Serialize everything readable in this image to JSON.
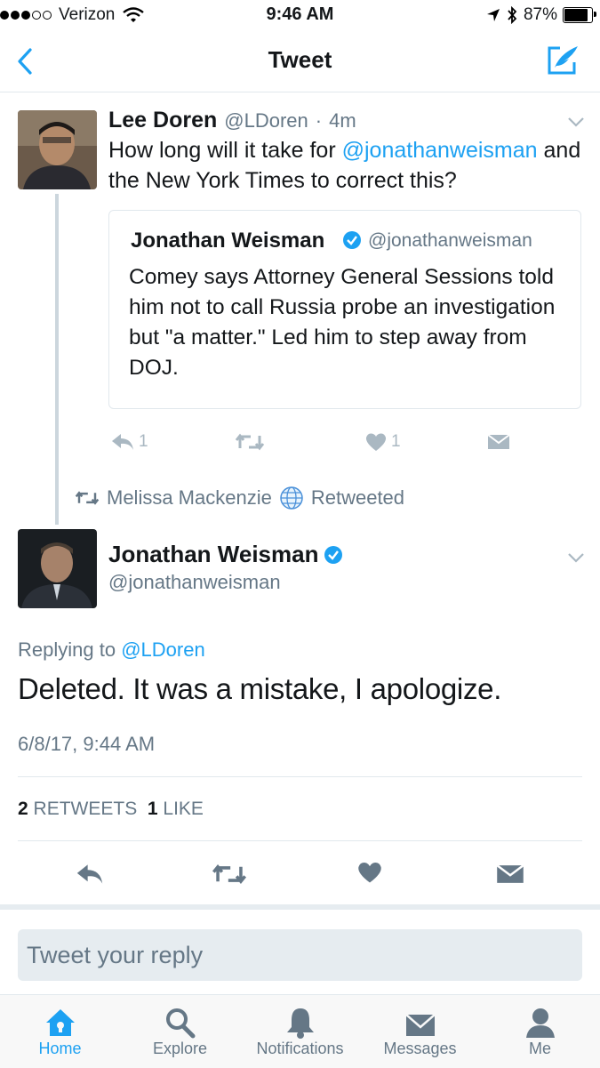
{
  "status_bar": {
    "carrier": "Verizon",
    "time": "9:46 AM",
    "battery": "87%",
    "battery_level": 0.87
  },
  "nav": {
    "title": "Tweet"
  },
  "quoting_tweet": {
    "name": "Lee Doren",
    "handle": "@LDoren",
    "age": "4m",
    "text_before": "How long will it take for ",
    "mention": "@jonathanweisman",
    "text_after": " and the New York Times to correct this?",
    "actions": {
      "reply_count": "1",
      "like_count": "1"
    }
  },
  "quoted_tweet": {
    "name": "Jonathan Weisman",
    "handle": "@jonathanweisman",
    "text": "Comey says Attorney General Sessions told him not to call Russia probe an investigation but \"a matter.\" Led him to step away from DOJ."
  },
  "retweet_line": {
    "user": "Melissa Mackenzie",
    "suffix": "Retweeted"
  },
  "main_tweet": {
    "name": "Jonathan Weisman",
    "handle": "@jonathanweisman",
    "replying_prefix": "Replying to",
    "replying_to": "@LDoren",
    "text": "Deleted. It was a mistake, I apologize.",
    "timestamp": "6/8/17, 9:44 AM",
    "retweet_count": "2",
    "retweet_label": "RETWEETS",
    "like_count": "1",
    "like_label": "LIKE"
  },
  "reply_box": {
    "placeholder": "Tweet your reply"
  },
  "tabs": [
    {
      "label": "Home",
      "icon": "home-icon"
    },
    {
      "label": "Explore",
      "icon": "search-icon"
    },
    {
      "label": "Notifications",
      "icon": "bell-icon"
    },
    {
      "label": "Messages",
      "icon": "envelope-icon"
    },
    {
      "label": "Me",
      "icon": "person-icon"
    }
  ],
  "colors": {
    "accent": "#1da1f2",
    "muted": "#657786",
    "icon_gray": "#aab8c2",
    "text": "#14171a"
  }
}
